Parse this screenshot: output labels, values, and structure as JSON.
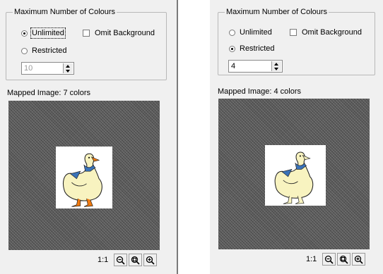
{
  "panels": [
    {
      "group_title": "Maximum Number of Colours",
      "options": {
        "unlimited": "Unlimited",
        "restricted": "Restricted",
        "omit_background": "Omit Background"
      },
      "selected": "unlimited",
      "spinner_value": "10",
      "spinner_enabled": false,
      "mapped_label": "Mapped Image: 7 colors",
      "zoom_label": "1:1"
    },
    {
      "group_title": "Maximum Number of Colours",
      "options": {
        "unlimited": "Unlimited",
        "restricted": "Restricted",
        "omit_background": "Omit Background"
      },
      "selected": "restricted",
      "spinner_value": "4",
      "spinner_enabled": true,
      "mapped_label": "Mapped Image: 4 colors",
      "zoom_label": "1:1"
    }
  ],
  "icons": [
    "zoom-out-icon",
    "zoom-fit-icon",
    "zoom-in-icon"
  ],
  "colors": {
    "panel_bg": "#f0f0f0",
    "preview_bg": "#595959",
    "duck_body": "#f8f3c0",
    "duck_scarf": "#3a72b8",
    "duck_feet": "#f07a10"
  }
}
